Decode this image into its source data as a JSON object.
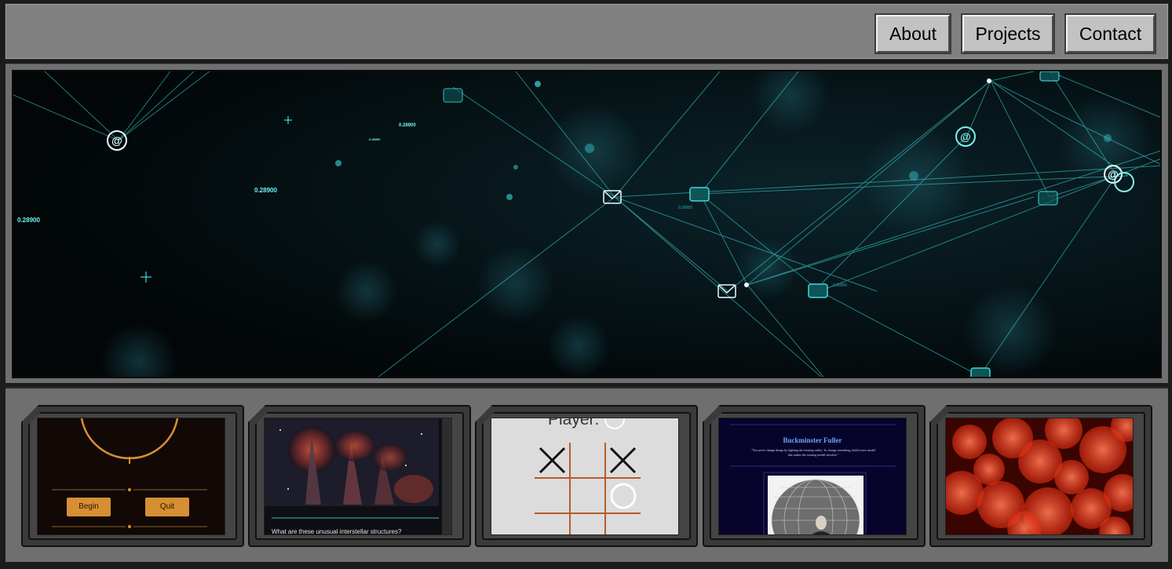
{
  "nav": {
    "about": "About",
    "projects": "Projects",
    "contact": "Contact"
  },
  "hero": {
    "readouts": [
      "0.28900",
      "0.28900",
      "0.28900",
      "0.28900",
      "0.28900",
      "0.28900"
    ]
  },
  "projects": [
    {
      "name": "game-menu",
      "begin": "Begin",
      "quit": "Quit"
    },
    {
      "name": "interstellar",
      "caption": "What are these unusual interstellar structures?"
    },
    {
      "name": "tic-tac-toe",
      "player_label": "Player:"
    },
    {
      "name": "buckminster-fuller",
      "title": "Buckminster Fuller",
      "quote": "\"You never change things by fighting the existing reality. To change something, build a new model that makes the existing model obsolete.\""
    },
    {
      "name": "bokeh"
    }
  ],
  "colors": {
    "frame": "#808080",
    "network": "#3fd8dc",
    "orange": "#d68f32"
  }
}
